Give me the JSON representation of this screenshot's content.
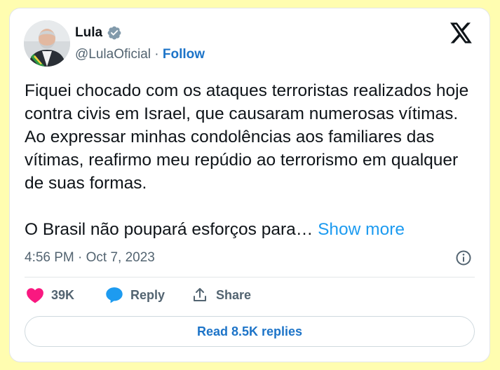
{
  "author": {
    "name": "Lula",
    "handle": "@LulaOficial",
    "separator": "·",
    "follow_label": "Follow",
    "verified_color": "#829aab"
  },
  "tweet": {
    "paragraph1": "Fiquei chocado com os ataques terroristas realizados hoje contra civis em Israel, que causaram numerosas vítimas. Ao expressar minhas condolências aos familiares das vítimas, reafirmo meu repúdio ao terrorismo em qualquer de suas formas.",
    "paragraph2": "O Brasil não poupará esforços para…",
    "show_more_label": "Show more",
    "timestamp": "4:56 PM · Oct 7, 2023"
  },
  "actions": {
    "likes_count": "39K",
    "reply_label": "Reply",
    "share_label": "Share"
  },
  "footer": {
    "read_replies_label": "Read 8.5K replies"
  },
  "icons": {
    "brand": "x-logo-icon",
    "info": "info-icon",
    "like": "heart-icon",
    "reply": "speech-bubble-icon",
    "share": "share-icon",
    "verified": "verified-badge-icon"
  },
  "colors": {
    "page_background": "#fffdb0",
    "heart": "#f91880",
    "reply_bubble": "#1d9bf0",
    "link": "#1d74c8",
    "show_more": "#1d9bf0"
  }
}
